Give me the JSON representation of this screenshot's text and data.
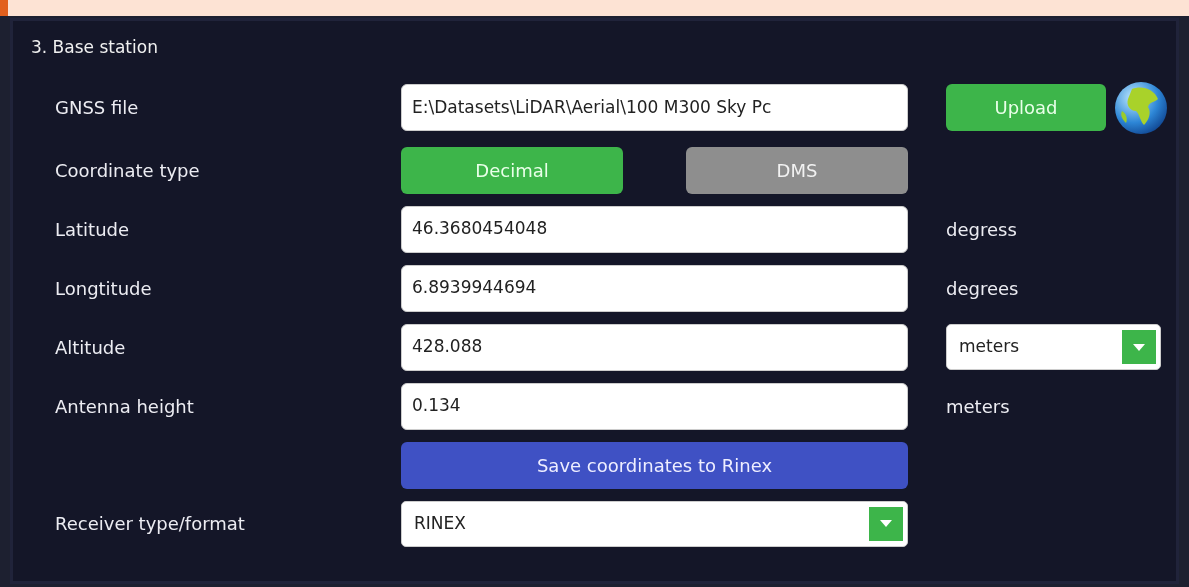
{
  "section_title": "3. Base station",
  "rows": [
    {
      "kind": "file",
      "label": "GNSS file",
      "value": "E:\\Datasets\\LiDAR\\Aerial\\100 M300 Sky Pc",
      "button": "Upload"
    },
    {
      "kind": "toggle",
      "label": "Coordinate type",
      "options": [
        {
          "label": "Decimal",
          "selected": true
        },
        {
          "label": "DMS",
          "selected": false
        }
      ]
    },
    {
      "kind": "input",
      "label": "Latitude",
      "value": "46.3680454048",
      "unit": "degress"
    },
    {
      "kind": "input",
      "label": "Longtitude",
      "value": "6.8939944694",
      "unit": "degrees"
    },
    {
      "kind": "unit_select",
      "label": "Altitude",
      "value": "428.088",
      "unit": "meters"
    },
    {
      "kind": "input",
      "label": "Antenna height",
      "value": "0.134",
      "unit": "meters"
    },
    {
      "kind": "action",
      "button": "Save coordinates to Rinex"
    },
    {
      "kind": "select",
      "label": "Receiver type/format",
      "value": "RINEX"
    }
  ]
}
